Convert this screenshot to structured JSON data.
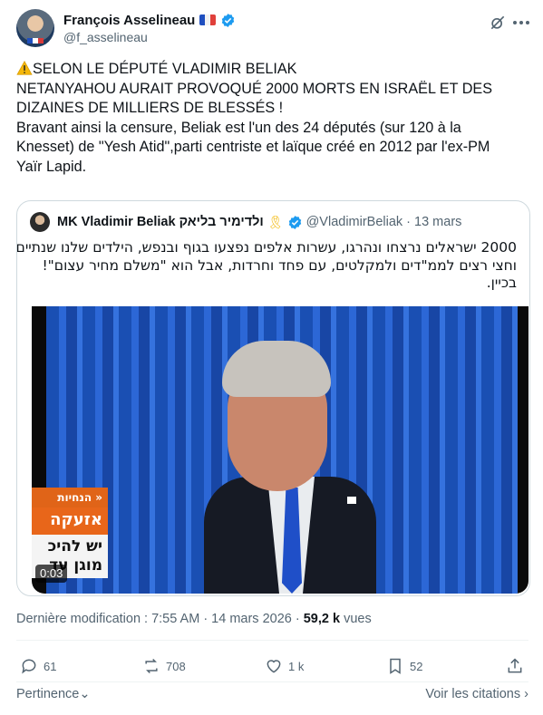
{
  "author": {
    "display_name": "François Asselineau",
    "handle": "@f_asselineau"
  },
  "icons": {
    "flag": "france-flag-icon",
    "verified": "verified-badge-icon",
    "grok": "grok-icon",
    "more": "more-icon",
    "warning": "warning-icon"
  },
  "tweet": {
    "lines": [
      "SELON LE DÉPUTÉ VLADIMIR BELIAK",
      "NETANYAHOU AURAIT PROVOQUÉ 2000 MORTS EN ISRAËL ET DES",
      "DIZAINES DE MILLIERS DE BLESSÉS !",
      "Bravant ainsi la censure, Beliak est l'un des 24 députés (sur 120 à la",
      "Knesset) de \"Yesh Atid\",parti centriste et laïque créé en 2012 par l'ex-PM",
      "Yaïr Lapid."
    ]
  },
  "quoted": {
    "name": "MK Vladimir Beliak ולדימיר בליאק",
    "ribbon": "🎗",
    "handle": "@VladimirBeliak",
    "dot": "·",
    "date": "13 mars",
    "text_lines": [
      "2000 ישראלים נרצחו ונהרגו, עשרות אלפים נפצעו בגוף ובנפש, הילדים שלנו שנתיים",
      "וחצי רצים לממ\"דים ולמקלטים, עם פחד וחרדות, אבל הוא \"משלם מחיר עצום\"!",
      "בכיין."
    ],
    "video": {
      "news_tag": "« הנחיות",
      "news_alert": "אזעקה",
      "news_line1": "יש להיכ",
      "news_line2": "מוגן עד",
      "timecode": "0:03"
    }
  },
  "meta": {
    "modified_label": "Dernière modification : 7:55 AM · 14 mars 2026 ·",
    "views_count": "59,2 k",
    "views_label": "vues"
  },
  "actions": {
    "replies": "61",
    "reposts": "708",
    "likes": "1 k",
    "bookmarks": "52"
  },
  "footer": {
    "relevance": "Pertinence",
    "relevance_arrow": "⌄",
    "quotes": "Voir les citations",
    "quotes_arrow": "›"
  },
  "colors": {
    "text": "#0f1419",
    "secondary": "#536471",
    "verified": "#1d9bf0",
    "border": "#cfd9de"
  }
}
